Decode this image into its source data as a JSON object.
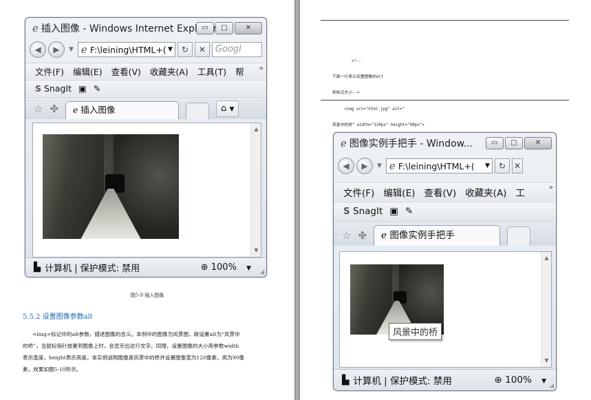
{
  "left_page": {
    "window": {
      "title": "插入图像 - Windows Internet Explorer",
      "address": "F:\\leining\\HTML+(",
      "search_placeholder": "Googl",
      "menu": [
        "文件(F)",
        "编辑(E)",
        "查看(V)",
        "收藏夹(A)",
        "工具(T)",
        "帮"
      ],
      "snagit_label": "SnagIt",
      "tab_label": "插入图像",
      "status_text": "计算机 | 保护模式: 禁用",
      "zoom": "100%"
    },
    "figure_caption": "图5-9   插入图像",
    "section_heading": "5.5.2   设置图像参数alt",
    "paragraph_lines": [
      "<img>标记中的alt参数，描述图像的含义。本例中的图像为风景图，故设置alt为“风景中",
      "的桥”，当鼠标指针放置到图像上时，会显示出这行文字。同理，设置图像的大小用参数width",
      "表示宽度，height表示高度。本实例说明图像是风景中的桥并设置图像宽为120像素，高为90像",
      "素，效果如图5-10所示。"
    ]
  },
  "right_page": {
    "code_lines": [
      "        <!--",
      "下面一行表示设置图像的alt",
      "和标记大小-->",
      "     <img src=\"html.jpg\" alt=\"",
      "风景中的桥\" width=\"120px\" height=\"90px\">"
    ],
    "window": {
      "title": "图像实例手把手 - Window...",
      "address": "F:\\leining\\HTML+(",
      "menu": [
        "文件(F)",
        "编辑(E)",
        "查看(V)",
        "收藏夹(A)",
        "工"
      ],
      "snagit_label": "SnagIt",
      "tab_label": "图像实例手把手",
      "tooltip": "风景中的桥",
      "status_text": "计算机 | 保护模式: 禁用",
      "zoom": "100%"
    }
  },
  "icons": {
    "ie_logo": "ℯ",
    "back": "◀",
    "forward": "▶",
    "dropdown": "▼",
    "refresh": "↻",
    "stop": "✕",
    "favorites_star": "☆",
    "add_favorites": "✤",
    "home": "⌂",
    "computer": "▙",
    "zoom": "⊕",
    "minimize": "▭",
    "maximize": "□",
    "close": "✕",
    "more": "»",
    "snagit": "S",
    "snagit_capture": "▣",
    "snagit_edit": "✎"
  }
}
